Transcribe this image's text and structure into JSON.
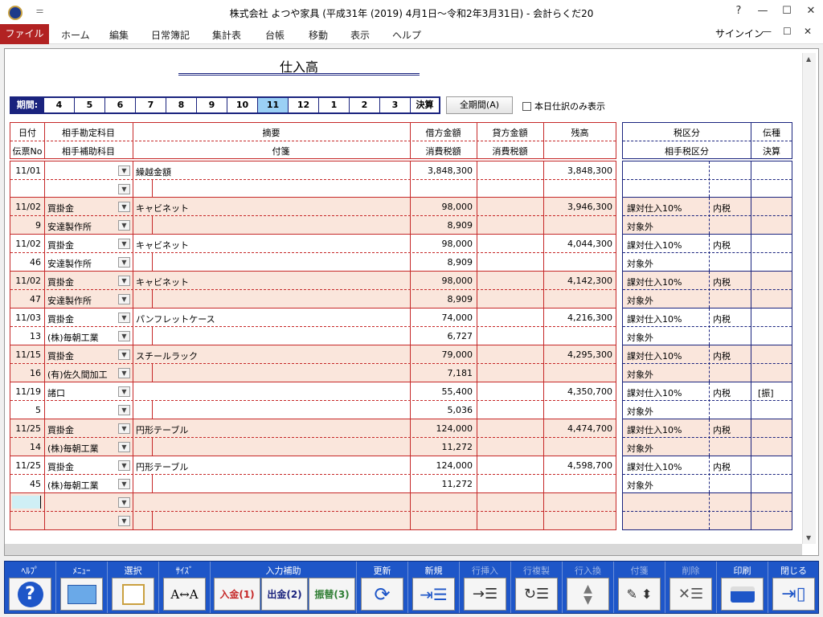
{
  "window": {
    "title": "株式会社 よつや家具 (平成31年 (2019) 4月1日～令和2年3月31日) - 会計らくだ20",
    "qat": "＝",
    "help": "?",
    "minimize": "—",
    "maximize": "☐",
    "close": "✕"
  },
  "menu": {
    "file": "ファイル",
    "items": [
      "ホーム",
      "編集",
      "日常簿記",
      "集計表",
      "台帳",
      "移動",
      "表示",
      "ヘルプ"
    ],
    "signin": "サインイン"
  },
  "report": {
    "title": "仕入高"
  },
  "periods": {
    "label": "期間:",
    "items": [
      "4",
      "5",
      "6",
      "7",
      "8",
      "9",
      "10",
      "11",
      "12",
      "1",
      "2",
      "3",
      "決算"
    ],
    "selected": "11"
  },
  "all_period_button": "全期間(A)",
  "today_only_label": "本日仕訳のみ表示",
  "headers": {
    "row1": {
      "date": "日付",
      "account": "相手勘定科目",
      "memo": "摘要",
      "debit": "借方金額",
      "credit": "貸方金額",
      "balance": "残高"
    },
    "row2": {
      "slip": "伝票No",
      "subaccount": "相手補助科目",
      "tag": "付箋",
      "debit_tax": "消費税額",
      "credit_tax": "消費税額"
    },
    "tax_row1": {
      "tax": "税区分",
      "slip_type": "伝種"
    },
    "tax_row2": {
      "partner_tax": "相手税区分",
      "settle": "決算"
    }
  },
  "rows": [
    {
      "date": "11/01",
      "slip": "",
      "account": "",
      "subaccount": "",
      "memo": "繰越金額",
      "debit": "",
      "tax": "",
      "balance": "3,848,300",
      "debit_balance": "3,848,300",
      "tax_cat": "",
      "tax_kind": "",
      "tax2": "",
      "slip_type": "",
      "alt": false
    },
    {
      "date": "11/02",
      "slip": "9",
      "account": "買掛金",
      "subaccount": "安達製作所",
      "memo": "キャビネット",
      "debit": "98,000",
      "tax": "8,909",
      "balance": "3,946,300",
      "tax_cat": "課対仕入10%",
      "tax_kind": "内税",
      "tax2": "対象外",
      "slip_type": "",
      "alt": true
    },
    {
      "date": "11/02",
      "slip": "46",
      "account": "買掛金",
      "subaccount": "安達製作所",
      "memo": "キャビネット",
      "debit": "98,000",
      "tax": "8,909",
      "balance": "4,044,300",
      "tax_cat": "課対仕入10%",
      "tax_kind": "内税",
      "tax2": "対象外",
      "slip_type": "",
      "alt": false
    },
    {
      "date": "11/02",
      "slip": "47",
      "account": "買掛金",
      "subaccount": "安達製作所",
      "memo": "キャビネット",
      "debit": "98,000",
      "tax": "8,909",
      "balance": "4,142,300",
      "tax_cat": "課対仕入10%",
      "tax_kind": "内税",
      "tax2": "対象外",
      "slip_type": "",
      "alt": true
    },
    {
      "date": "11/03",
      "slip": "13",
      "account": "買掛金",
      "subaccount": "(株)毎朝工業",
      "memo": "パンフレットケース",
      "debit": "74,000",
      "tax": "6,727",
      "balance": "4,216,300",
      "tax_cat": "課対仕入10%",
      "tax_kind": "内税",
      "tax2": "対象外",
      "slip_type": "",
      "alt": false
    },
    {
      "date": "11/15",
      "slip": "16",
      "account": "買掛金",
      "subaccount": "(有)佐久間加工",
      "memo": "スチールラック",
      "debit": "79,000",
      "tax": "7,181",
      "balance": "4,295,300",
      "tax_cat": "課対仕入10%",
      "tax_kind": "内税",
      "tax2": "対象外",
      "slip_type": "",
      "alt": true
    },
    {
      "date": "11/19",
      "slip": "5",
      "account": "諸口",
      "subaccount": "",
      "memo": "",
      "debit": "55,400",
      "tax": "5,036",
      "balance": "4,350,700",
      "tax_cat": "課対仕入10%",
      "tax_kind": "内税",
      "tax2": "対象外",
      "slip_type": "[振]",
      "alt": false
    },
    {
      "date": "11/25",
      "slip": "14",
      "account": "買掛金",
      "subaccount": "(株)毎朝工業",
      "memo": "円形テーブル",
      "debit": "124,000",
      "tax": "11,272",
      "balance": "4,474,700",
      "tax_cat": "課対仕入10%",
      "tax_kind": "内税",
      "tax2": "対象外",
      "slip_type": "",
      "alt": true
    },
    {
      "date": "11/25",
      "slip": "45",
      "account": "買掛金",
      "subaccount": "(株)毎朝工業",
      "memo": "円形テーブル",
      "debit": "124,000",
      "tax": "11,272",
      "balance": "4,598,700",
      "tax_cat": "課対仕入10%",
      "tax_kind": "内税",
      "tax2": "対象外",
      "slip_type": "",
      "alt": false
    },
    {
      "date": "",
      "slip": "",
      "account": "",
      "subaccount": "",
      "memo": "",
      "debit": "",
      "tax": "",
      "balance": "",
      "tax_cat": "",
      "tax_kind": "",
      "tax2": "",
      "slip_type": "",
      "alt": true
    }
  ],
  "toolbar": {
    "help": "ﾍﾙﾌﾟ",
    "menu": "ﾒﾆｭｰ",
    "select": "選択",
    "size": "ｻｲｽﾞ",
    "input_assist": "入力補助",
    "deposit": "入金(1)",
    "withdraw": "出金(2)",
    "transfer": "振替(3)",
    "refresh": "更新",
    "new": "新規",
    "row_insert": "行挿入",
    "row_copy": "行複製",
    "row_swap": "行入換",
    "tag": "付箋",
    "delete": "削除",
    "print": "印刷",
    "close": "閉じる",
    "size_icon_text": "A↔A"
  },
  "colors": {
    "accent": "#b22222",
    "grid_red": "#c62828",
    "grid_navy": "#1a237e",
    "alt_row": "#fae6dc",
    "toolbar": "#1e56c8",
    "selected_period": "#9bd0f5"
  }
}
